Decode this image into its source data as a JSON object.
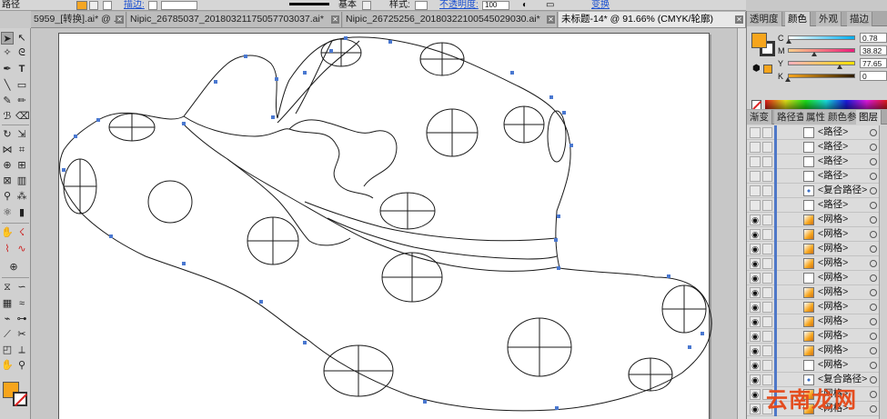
{
  "control_bar": {
    "object_label": "路径",
    "stroke_label": "描边:",
    "basic_label": "基本",
    "style_label": "样式:",
    "opacity_label": "不透明度:",
    "opacity_value": "100",
    "transform_label": "变换"
  },
  "tabs": [
    {
      "label": "5959_[转换].ai* @ ...",
      "active": false
    },
    {
      "label": "Nipic_26785037_20180321175057703037.ai*",
      "active": false
    },
    {
      "label": "Nipic_26725256_20180322100545029030.ai*",
      "active": false
    },
    {
      "label": "未标题-14* @ 91.66% (CMYK/轮廓)",
      "active": true
    }
  ],
  "panel_tabs_top": [
    "透明度",
    "颜色",
    "外观",
    "描边"
  ],
  "color_panel": {
    "channels": [
      {
        "label": "C",
        "value": "0.78",
        "fraction": 0.008,
        "from": "#ffffff",
        "to": "#00aeef"
      },
      {
        "label": "M",
        "value": "38.82",
        "fraction": 0.388,
        "from": "#ffd08a",
        "to": "#ec1c7a"
      },
      {
        "label": "Y",
        "value": "77.65",
        "fraction": 0.776,
        "from": "#f7b0c0",
        "to": "#f6e000"
      },
      {
        "label": "K",
        "value": "0",
        "fraction": 0.0,
        "from": "#f7a51c",
        "to": "#2b1a00"
      }
    ],
    "fill_color": "#f7a51c"
  },
  "panel_tabs_bottom": [
    "渐变",
    "路径查",
    "属性",
    "颜色参",
    "图层"
  ],
  "layers": [
    {
      "name": "<路径>",
      "visible": false,
      "thumb": "blank"
    },
    {
      "name": "<路径>",
      "visible": false,
      "thumb": "blank"
    },
    {
      "name": "<路径>",
      "visible": false,
      "thumb": "blank"
    },
    {
      "name": "<路径>",
      "visible": false,
      "thumb": "blank"
    },
    {
      "name": "<复合路径>",
      "visible": false,
      "thumb": "dots"
    },
    {
      "name": "<路径>",
      "visible": false,
      "thumb": "blank"
    },
    {
      "name": "<网格>",
      "visible": true,
      "thumb": "orange"
    },
    {
      "name": "<网格>",
      "visible": true,
      "thumb": "orange"
    },
    {
      "name": "<网格>",
      "visible": true,
      "thumb": "orange"
    },
    {
      "name": "<网格>",
      "visible": true,
      "thumb": "orange"
    },
    {
      "name": "<网格>",
      "visible": true,
      "thumb": "blank"
    },
    {
      "name": "<网格>",
      "visible": true,
      "thumb": "orange"
    },
    {
      "name": "<网格>",
      "visible": true,
      "thumb": "orange"
    },
    {
      "name": "<网格>",
      "visible": true,
      "thumb": "orange"
    },
    {
      "name": "<网格>",
      "visible": true,
      "thumb": "orange"
    },
    {
      "name": "<网格>",
      "visible": true,
      "thumb": "orange"
    },
    {
      "name": "<网格>",
      "visible": true,
      "thumb": "blank"
    },
    {
      "name": "<复合路径>",
      "visible": true,
      "thumb": "dots"
    },
    {
      "name": "<网格>",
      "visible": true,
      "thumb": "orange"
    },
    {
      "name": "<网格>",
      "visible": true,
      "thumb": "orange"
    }
  ],
  "watermark": "云南龙网"
}
